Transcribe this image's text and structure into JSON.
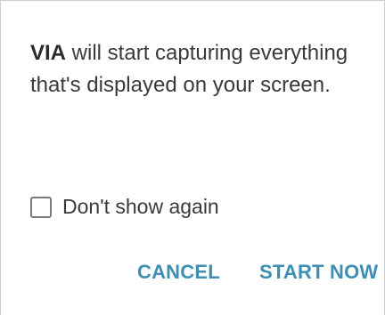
{
  "dialog": {
    "message_app_name": "VIA",
    "message_text": " will start capturing everything that's displayed on your screen.",
    "checkbox": {
      "label": "Don't show again",
      "checked": false
    },
    "buttons": {
      "cancel_label": "CANCEL",
      "start_label": "START NOW"
    }
  },
  "colors": {
    "accent": "#3d8fb4",
    "text": "#3a3a3a",
    "background": "#ffffff"
  }
}
